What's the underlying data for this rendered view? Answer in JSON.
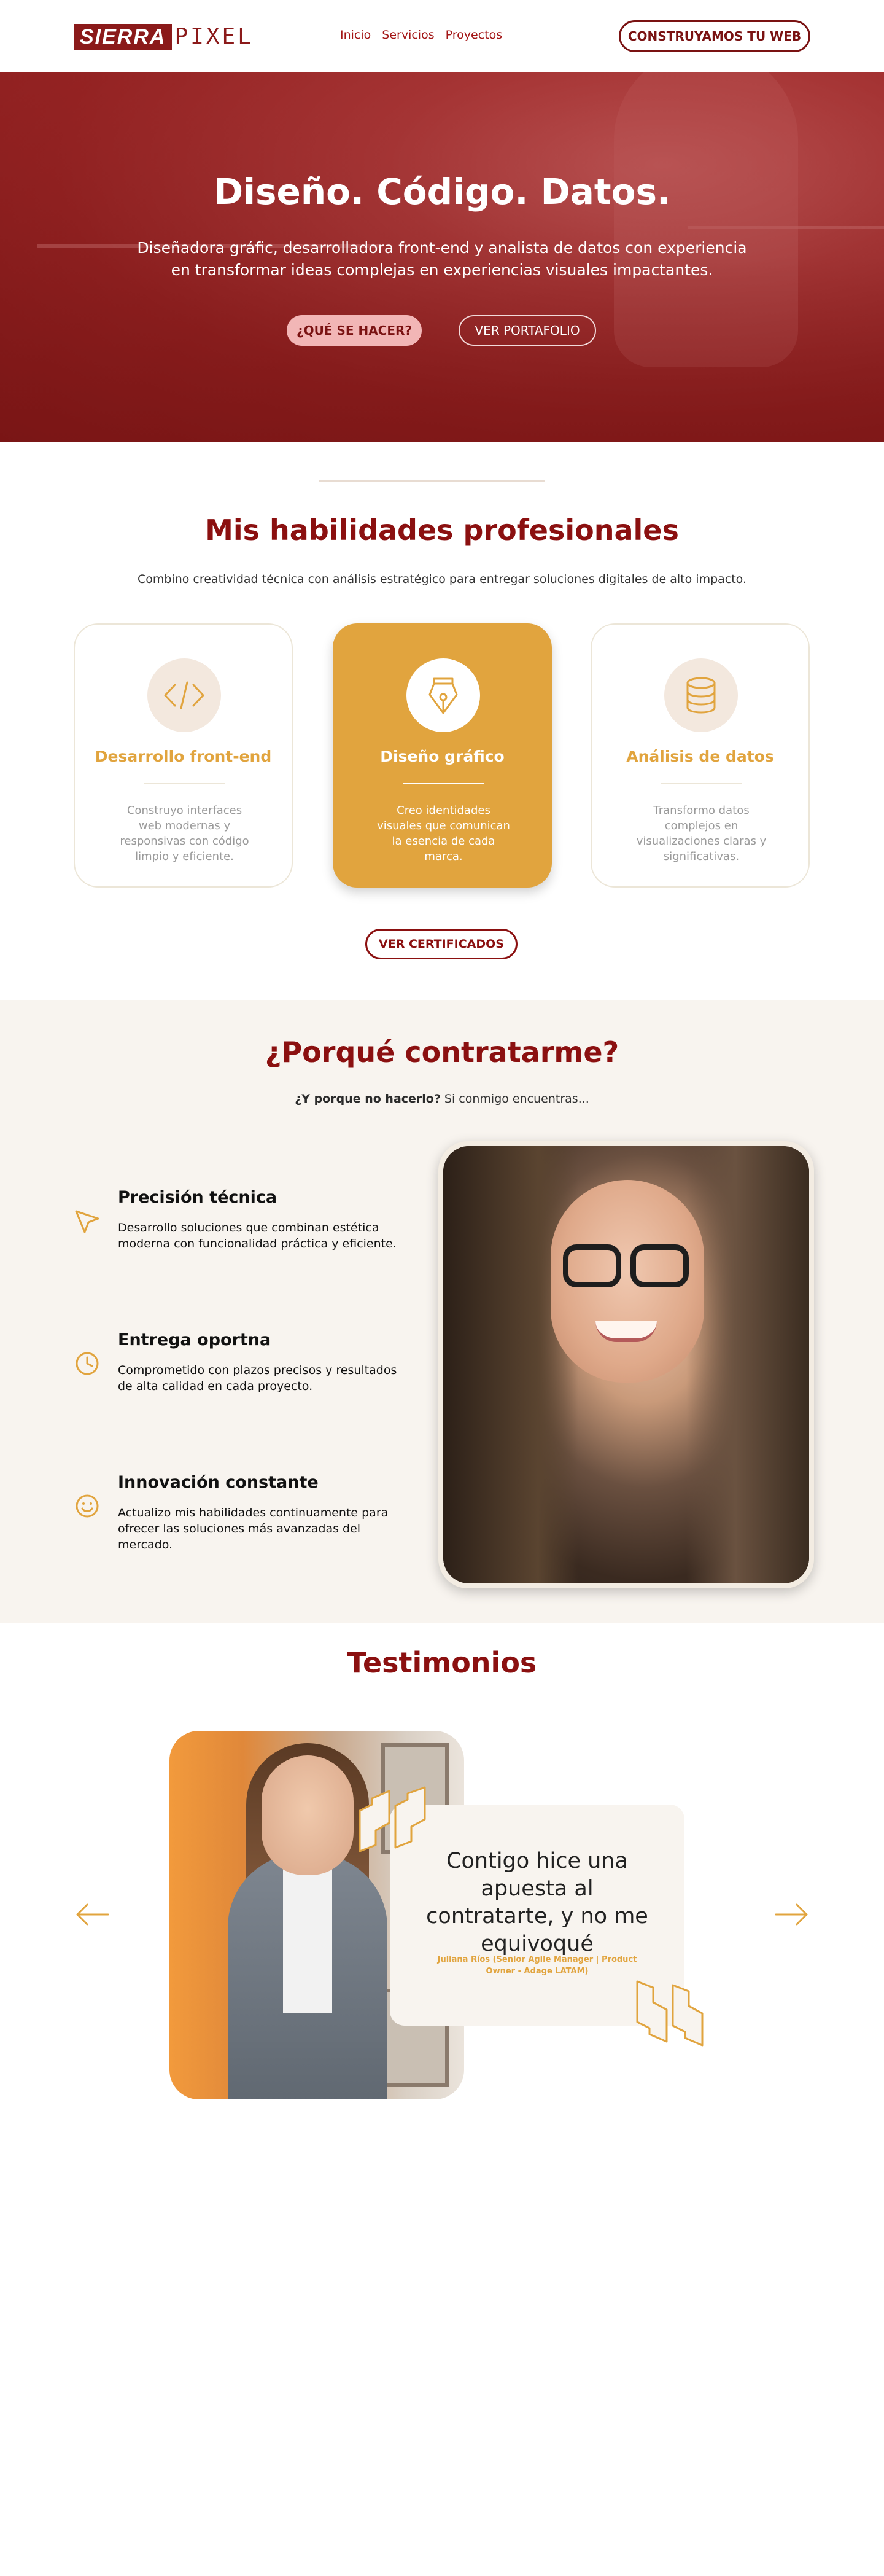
{
  "header": {
    "logo_box": "SIERRA",
    "logo_text": "PIXEL",
    "nav": [
      "Inicio",
      "Servicios",
      "Proyectos"
    ],
    "cta": "CONSTRUYAMOS TU WEB"
  },
  "hero": {
    "title": "Diseño. Código. Datos.",
    "subtitle": "Diseñadora gráfic, desarrolladora front-end y analista de datos con experiencia en transformar ideas complejas en experiencias visuales impactantes.",
    "btn_primary": "¿QUÉ SE HACER?",
    "btn_secondary": "VER PORTAFOLIO"
  },
  "skills": {
    "title": "Mis habilidades profesionales",
    "subtitle": "Combino creatividad técnica con análisis estratégico para entregar soluciones digitales de alto impacto.",
    "cards": [
      {
        "title": "Desarrollo front-end",
        "desc": "Construyo interfaces web modernas y responsivas con código limpio y eficiente.",
        "icon": "code-icon"
      },
      {
        "title": "Diseño gráfico",
        "desc": "Creo identidades visuales que comunican la esencia de cada marca.",
        "icon": "pen-nib-icon"
      },
      {
        "title": "Análisis de datos",
        "desc": "Transformo datos complejos en visualizaciones claras y significativas.",
        "icon": "database-icon"
      }
    ],
    "cert_button": "VER CERTIFICADOS"
  },
  "why": {
    "title": "¿Porqué contratarme?",
    "sub_bold": "¿Y porque no hacerlo?",
    "sub_rest": " Si conmigo encuentras...",
    "features": [
      {
        "title": "Precisión técnica",
        "desc": "Desarrollo soluciones que combinan estética moderna con funcionalidad práctica y eficiente.",
        "icon": "cursor-arrow-icon"
      },
      {
        "title": "Entrega oportna",
        "desc": "Comprometido con plazos precisos y resultados de alta calidad en cada proyecto.",
        "icon": "clock-icon"
      },
      {
        "title": "Innovación constante",
        "desc": "Actualizo mis habilidades continuamente para ofrecer las soluciones más avanzadas del mercado.",
        "icon": "smiley-icon"
      }
    ]
  },
  "testimonials": {
    "title": "Testimonios",
    "quote": "Contigo hice una apuesta al contratarte, y no me equivoqué",
    "author": "Juliana Ríos (Senior Agile Manager | Product Owner - Adage LATAM)"
  },
  "colors": {
    "brand_red": "#8b1010",
    "accent_gold": "#e1a43e",
    "cream": "#f8f4ef"
  }
}
